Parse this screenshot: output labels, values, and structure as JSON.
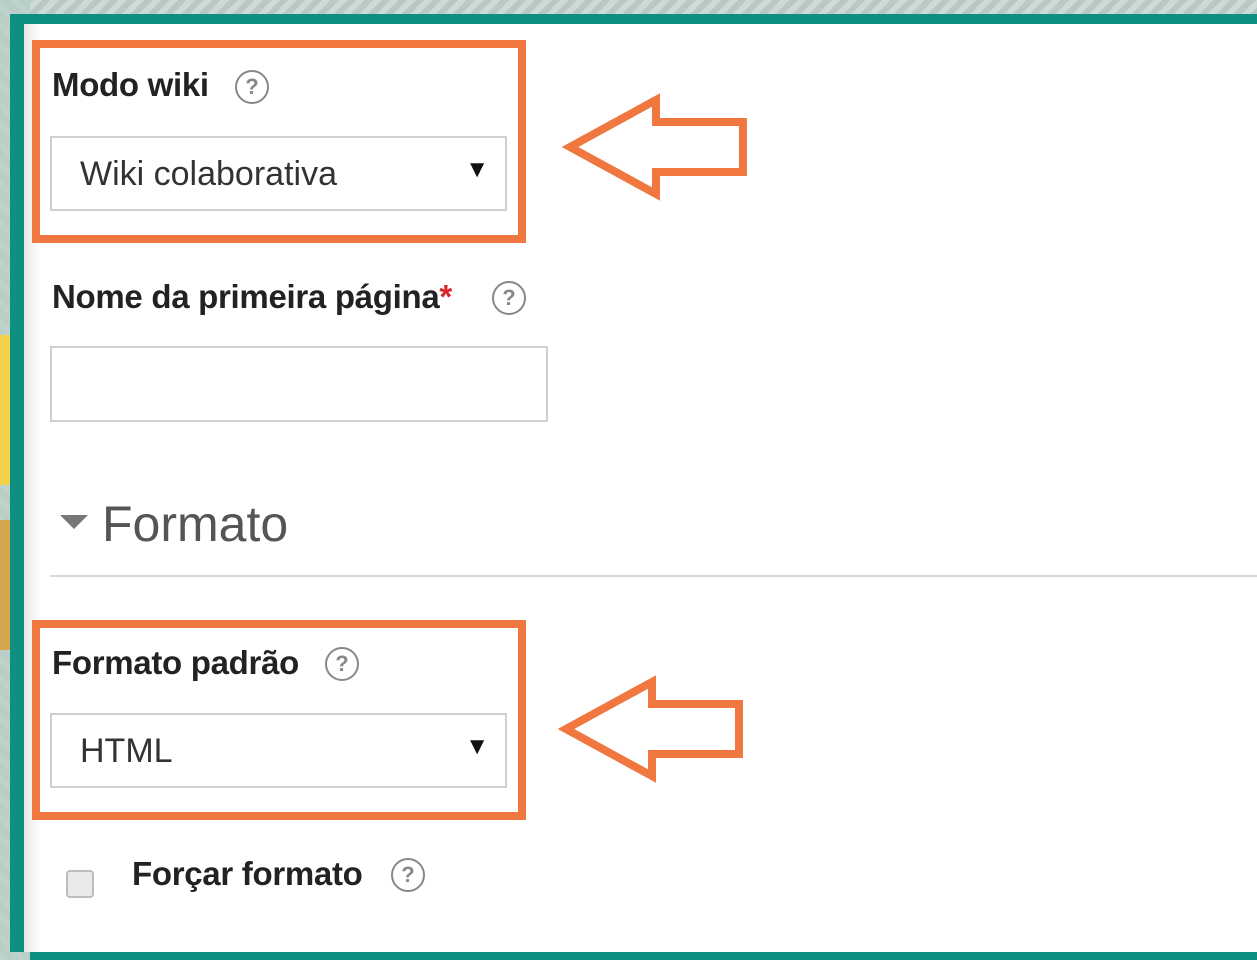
{
  "form": {
    "wiki_mode": {
      "label": "Modo wiki",
      "value": "Wiki colaborativa"
    },
    "first_page": {
      "label": "Nome da primeira página",
      "required_mark": "*",
      "value": ""
    },
    "format_section": {
      "title": "Formato"
    },
    "default_format": {
      "label": "Formato padrão",
      "value": "HTML"
    },
    "force_format": {
      "label": "Forçar formato",
      "checked": false
    },
    "help_glyph": "?",
    "select_caret": "▼"
  },
  "colors": {
    "highlight": "#f07840",
    "frame": "#0e8f7f",
    "required": "#d9262b"
  },
  "icons": [
    "help-icon",
    "dropdown-caret-icon",
    "collapse-caret-icon",
    "left-arrow-annotation"
  ]
}
